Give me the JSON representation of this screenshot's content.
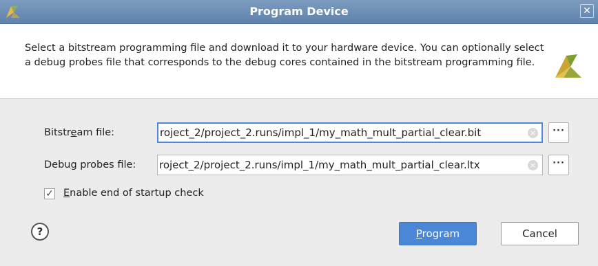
{
  "window": {
    "title": "Program Device",
    "close_glyph": "✕",
    "app_icon": "vivado-logo-icon"
  },
  "header": {
    "description": "Select a bitstream programming file and download it to your hardware device. You can optionally select a debug probes file that corresponds to the debug cores contained in the bitstream programming file.",
    "logo": "vivado-logo-icon"
  },
  "form": {
    "bitstream": {
      "label_pre": "Bitstr",
      "label_mnemonic": "e",
      "label_post": "am file:",
      "value": "roject_2/project_2.runs/impl_1/my_math_mult_partial_clear.bit",
      "browse_label": "···"
    },
    "debug_probes": {
      "label_pre": "Debu",
      "label_mnemonic": "g",
      "label_post": " probes file:",
      "value": "roject_2/project_2.runs/impl_1/my_math_mult_partial_clear.ltx",
      "browse_label": "···"
    },
    "startup_check": {
      "checked_glyph": "✓",
      "label_mnemonic": "E",
      "label_post": "nable end of startup check"
    }
  },
  "footer": {
    "help_label": "?",
    "program_mnemonic": "P",
    "program_post": "rogram",
    "cancel_label": "Cancel"
  },
  "colors": {
    "title_bar": "#6a8db8",
    "primary_button": "#4a87d6",
    "focus_border": "#4d89d6"
  }
}
